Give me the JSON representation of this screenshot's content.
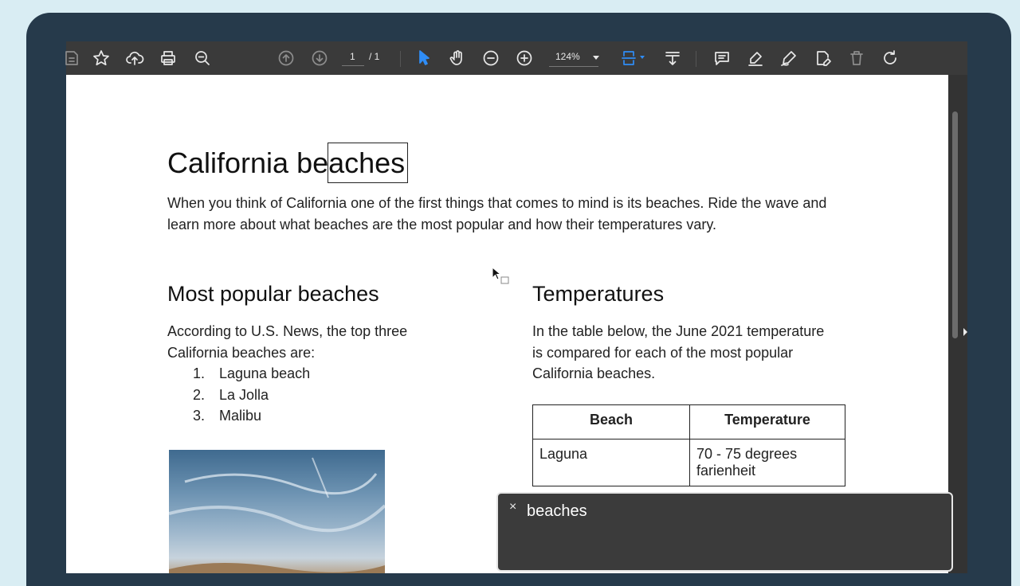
{
  "toolbar": {
    "page_current": "1",
    "page_total": "/ 1",
    "zoom": "124%",
    "icons": [
      "page-icon",
      "star-icon",
      "upload-icon",
      "print-icon",
      "zoom-out-search-icon",
      "prev-page-icon",
      "next-page-icon",
      "select-cursor-icon",
      "hand-icon",
      "zoom-out-icon",
      "zoom-in-icon",
      "fit-page-icon",
      "scroll-mode-icon",
      "comment-icon",
      "highlight-icon",
      "sign-icon",
      "edit-pdf-icon",
      "delete-icon",
      "rotate-icon"
    ]
  },
  "document": {
    "title": "California beaches",
    "intro": "When you think of California one of the first things that comes to mind is its beaches. Ride the wave and learn more about what beaches are the most popular and how their temperatures vary.",
    "popular": {
      "heading": "Most popular beaches",
      "text": "According to U.S. News, the top three California beaches are:",
      "items": [
        {
          "num": "1.",
          "label": "Laguna beach"
        },
        {
          "num": "2.",
          "label": "La Jolla"
        },
        {
          "num": "3.",
          "label": "Malibu"
        }
      ]
    },
    "temperatures": {
      "heading": "Temperatures",
      "text": "In the table below, the June 2021 temperature is compared for each of the most popular California beaches.",
      "table": {
        "headers": [
          "Beach",
          "Temperature"
        ],
        "rows": [
          [
            "Laguna",
            "70 - 75 degrees farienheit"
          ]
        ]
      }
    }
  },
  "find_panel": {
    "close": "×",
    "query": "beaches"
  },
  "colors": {
    "toolbar_bg": "#3a3a3a",
    "accent": "#2f8df6",
    "frame": "#263a4b",
    "background": "#d9edf3"
  }
}
